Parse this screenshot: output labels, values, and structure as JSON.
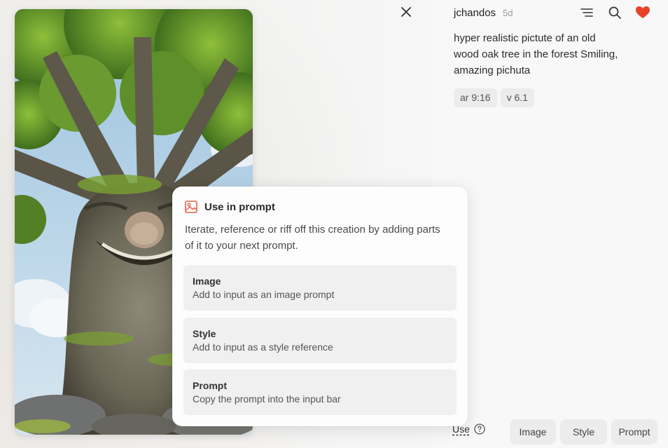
{
  "viewer": {
    "image_alt": "Smiling old oak tree face"
  },
  "post": {
    "username": "jchandos",
    "age": "5d",
    "prompt": "hyper realistic pictute of an old wood oak tree in the forest Smiling, amazing pichuta",
    "params": [
      "ar 9:16",
      "v 6.1"
    ]
  },
  "header_icons": [
    "menu-icon",
    "search-icon",
    "heart-icon"
  ],
  "popover": {
    "title": "Use in prompt",
    "description": "Iterate, reference or riff off this creation by adding parts of it to your next prompt.",
    "options": [
      {
        "title": "Image",
        "desc": "Add to input as an image prompt"
      },
      {
        "title": "Style",
        "desc": "Add to input as a style reference"
      },
      {
        "title": "Prompt",
        "desc": "Copy the prompt into the input bar"
      }
    ]
  },
  "footer": {
    "use_label": "Use",
    "buttons": [
      "Image",
      "Style",
      "Prompt"
    ]
  },
  "colors": {
    "heart": "#e8412a",
    "accent_icon": "#e8604a"
  }
}
